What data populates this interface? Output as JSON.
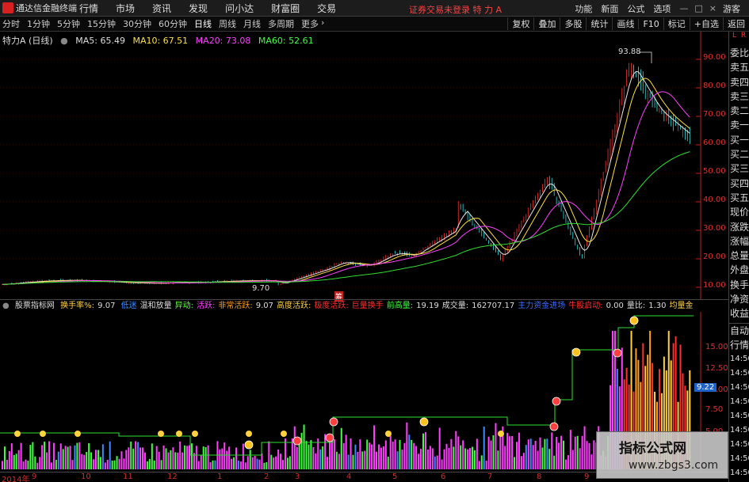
{
  "app": {
    "title": "通达信金融终端"
  },
  "menu": [
    "行情",
    "市场",
    "资讯",
    "发现",
    "问小达",
    "财富圈",
    "交易"
  ],
  "status": "证券交易未登录  特 力 A",
  "top_right": [
    "功能",
    "新面",
    "公式",
    "选项"
  ],
  "window_label": "游客",
  "periods": [
    "分时",
    "1分钟",
    "5分钟",
    "15分钟",
    "30分钟",
    "60分钟",
    "日线",
    "周线",
    "月线",
    "多周期",
    "更多"
  ],
  "tools": [
    "复权",
    "叠加",
    "多股",
    "统计",
    "画线",
    "F10",
    "标记",
    "+自选",
    "返回"
  ],
  "sidebar": [
    "委比",
    "卖五",
    "卖四",
    "卖三",
    "卖二",
    "卖一",
    "买一",
    "买二",
    "买三",
    "买四",
    "买五",
    "现价",
    "涨跌",
    "涨幅",
    "总量",
    "外盘",
    "换手",
    "净资",
    "收益"
  ],
  "sidebar_bottom": [
    "自动",
    "行情"
  ],
  "sidebar_lr": {
    "l": "L",
    "r": "R"
  },
  "info": {
    "stock": "特力A",
    "period": "(日线)",
    "ma5": "MA5: 65.49",
    "ma10": "MA10: 67.51",
    "ma20": "MA20: 73.08",
    "ma60": "MA60: 52.61"
  },
  "chart_labels": {
    "high": "93.88",
    "low": "9.70"
  },
  "price_axis": [
    "90.00",
    "80.00",
    "70.00",
    "60.00",
    "50.00",
    "40.00",
    "30.00",
    "20.00",
    "10.00"
  ],
  "ind_axis": [
    "15.00",
    "12.50",
    "10.00",
    "7.50",
    "5.00"
  ],
  "ind_current": "9.22",
  "time_col": [
    "14:50",
    "14:50",
    "14:50",
    "14:50",
    "14:50",
    "14:50",
    "14:50",
    "14:50",
    "14:50"
  ],
  "indicator": {
    "name": "股票指标网",
    "turnover_label": "换手率%:",
    "turnover_value": "9.07",
    "items": [
      {
        "text": "低迷",
        "color": "#3a8cff"
      },
      {
        "text": "温和放量",
        "color": "#dddddd"
      },
      {
        "text": "异动:",
        "color": "#60ff40"
      },
      {
        "text": "活跃:",
        "color": "#ff40ff"
      },
      {
        "text": "非常活跃:",
        "color": "#ffa020"
      },
      {
        "text": "9.07",
        "color": "#dddddd"
      },
      {
        "text": "高度活跃:",
        "color": "#ffd040"
      },
      {
        "text": "极度活跃:",
        "color": "#ff3030"
      },
      {
        "text": "巨量换手",
        "color": "#ff3030"
      },
      {
        "text": "前高量:",
        "color": "#40ff40"
      },
      {
        "text": "19.19",
        "color": "#dddddd"
      },
      {
        "text": "成交量:",
        "color": "#dddddd"
      },
      {
        "text": "162707.17",
        "color": "#dddddd"
      },
      {
        "text": "主力资金进场",
        "color": "#3a6cff"
      },
      {
        "text": "牛股启动:",
        "color": "#ff3030"
      },
      {
        "text": "0.00",
        "color": "#dddddd"
      },
      {
        "text": "量比:",
        "color": "#dddddd"
      },
      {
        "text": "1.30",
        "color": "#dddddd"
      },
      {
        "text": "均量金",
        "color": "#ffd040"
      }
    ]
  },
  "dates": [
    "2014年",
    "9",
    "10",
    "11",
    "12",
    "1",
    "2",
    "3",
    "4",
    "5",
    "6",
    "7",
    "8",
    "9"
  ],
  "watermark": {
    "title": "指标公式网",
    "url": "www.zbgs3.com"
  },
  "tags": {
    "cost": "筹"
  }
}
